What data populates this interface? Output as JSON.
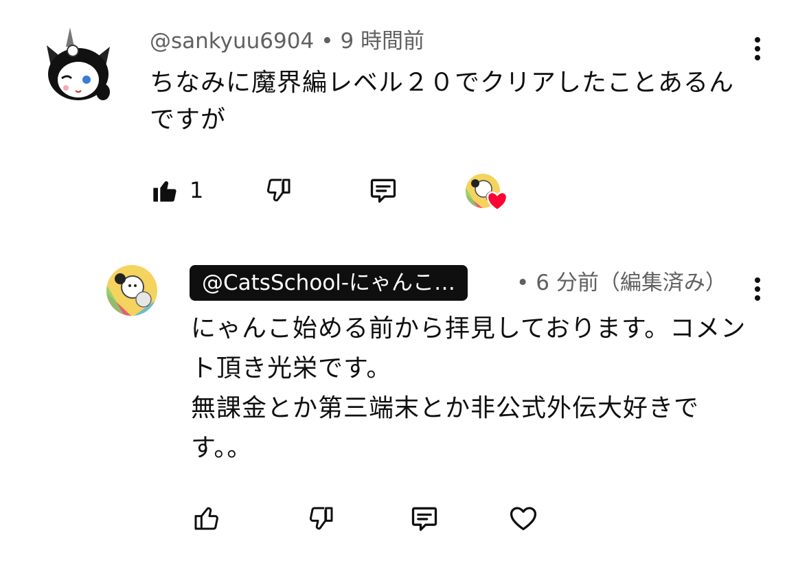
{
  "comment": {
    "author": "@sankyuu6904",
    "separator": "•",
    "time": "9 時間前",
    "text": "ちなみに魔界編レベル２０でクリアしたことあるんですが",
    "like_count": "1",
    "icons": [
      "thumb-up-filled-icon",
      "thumb-down-icon",
      "reply-icon",
      "creator-heart-icon",
      "more-vert-icon"
    ]
  },
  "reply": {
    "author": "@CatsSchool-にゃんこ…",
    "separator": "•",
    "time": "6 分前（編集済み）",
    "lines": [
      "にゃんこ始める前から拝見しております。コメント頂き光栄です。",
      "無課金とか第三端末とか非公式外伝大好きです。。"
    ],
    "icons": [
      "thumb-up-icon",
      "thumb-down-icon",
      "reply-icon",
      "heart-outline-icon",
      "more-vert-icon"
    ]
  },
  "colors": {
    "text": "#0f0f0f",
    "meta": "#606060",
    "heart": "#ff0033",
    "chip_bg": "#0f0f0f"
  }
}
